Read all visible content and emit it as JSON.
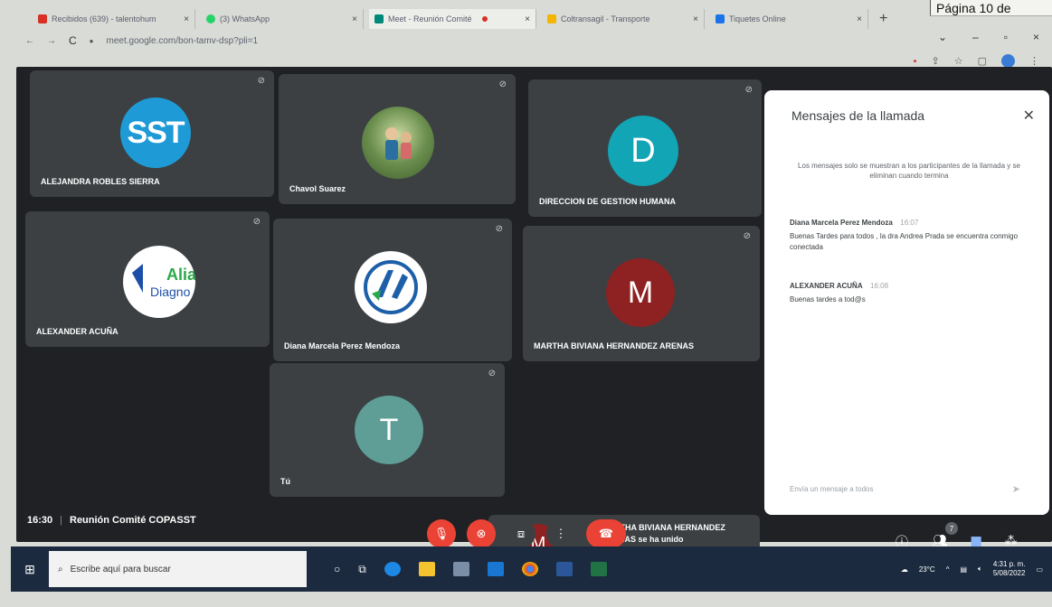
{
  "page_label": "Página 10 de",
  "browser": {
    "tabs": [
      {
        "label": "Recibidos (639) - talentohum",
        "color": "#d93025"
      },
      {
        "label": "(3) WhatsApp",
        "color": "#25d366"
      },
      {
        "label": "Meet - Reunión Comité",
        "color": "#00897b"
      },
      {
        "label": "Coltransagil - Transporte",
        "color": "#f4b400"
      },
      {
        "label": "Tiquetes Online",
        "color": "#1a73e8"
      }
    ],
    "active_tab": 2,
    "new_tab_label": "+",
    "url": "meet.google.com/bon-tamv-dsp?pli=1",
    "window_controls": [
      "⌄",
      "–",
      "▫",
      "×"
    ]
  },
  "meet": {
    "tiles": [
      {
        "name": "ALEJANDRA ROBLES SIERRA",
        "avatar_text": "SST",
        "avatar_color": "#1e9bd7",
        "avatar_kind": "text-sst"
      },
      {
        "name": "Chavol Suarez",
        "avatar_text": "",
        "avatar_color": "#6b8f4e",
        "avatar_kind": "photo"
      },
      {
        "name": "DIRECCION DE GESTION HUMANA",
        "avatar_text": "D",
        "avatar_color": "#12a5b5",
        "avatar_kind": "letter"
      },
      {
        "name": "ALEXANDER ACUÑA",
        "avatar_text": "Alia Diagno",
        "avatar_color": "#ffffff",
        "avatar_kind": "logo-alia"
      },
      {
        "name": "Diana Marcela Perez Mendoza",
        "avatar_text": "",
        "avatar_color": "#ffffff",
        "avatar_kind": "logo-d"
      },
      {
        "name": "MARTHA BIVIANA HERNANDEZ ARENAS",
        "avatar_text": "M",
        "avatar_color": "#8e2121",
        "avatar_kind": "letter"
      },
      {
        "name": "Tú",
        "avatar_text": "T",
        "avatar_color": "#5e9e96",
        "avatar_kind": "letter"
      }
    ],
    "toast": {
      "avatar_text": "M",
      "avatar_color": "#8e2121",
      "text": "MARTHA BIVIANA HERNANDEZ ARENAS se ha unido"
    },
    "time": "16:30",
    "meeting_name": "Reunión Comité COPASST",
    "participants_count": "7",
    "chat": {
      "title": "Mensajes de la llamada",
      "note": "Los mensajes solo se muestran a los participantes de la llamada y se eliminan cuando termina",
      "messages": [
        {
          "author": "Diana Marcela Perez Mendoza",
          "time": "16:07",
          "text": "Buenas Tardes para todos , la dra Andrea Prada se encuentra conmigo conectada"
        },
        {
          "author": "ALEXANDER ACUÑA",
          "time": "16:08",
          "text": "Buenas tardes a tod@s"
        }
      ],
      "input_placeholder": "Envía un mensaje a todos"
    }
  },
  "taskbar": {
    "search_placeholder": "Escribe aquí para buscar",
    "temperature": "23°C",
    "time": "4:31 p. m.",
    "date": "5/08/2022"
  }
}
